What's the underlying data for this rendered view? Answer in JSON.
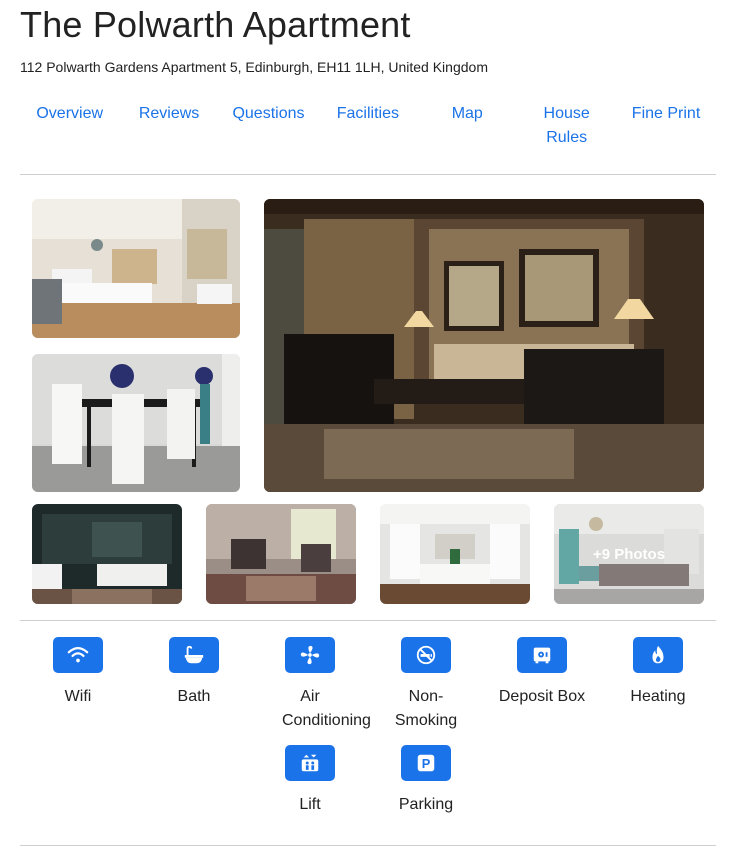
{
  "header": {
    "title": "The Polwarth Apartment",
    "address": "112 Polwarth Gardens Apartment 5, Edinburgh, EH11 1LH, United Kingdom"
  },
  "nav": [
    "Overview",
    "Reviews",
    "Questions",
    "Facilities",
    "Map",
    "House Rules",
    "Fine Print"
  ],
  "gallery": {
    "photos": [
      "bedroom-photo",
      "dining-room-photo",
      "living-room-photo",
      "bathroom-photo",
      "chairs-photo",
      "kitchen-photo",
      "lounge-photo"
    ],
    "more_photos_label": "+9 Photos"
  },
  "facilities": [
    {
      "label": "Wifi",
      "icon": "wifi-icon"
    },
    {
      "label": "Bath",
      "icon": "bath-icon"
    },
    {
      "label": "Air Conditioning",
      "icon": "fan-icon"
    },
    {
      "label": "Non-Smoking",
      "icon": "no-smoking-icon"
    },
    {
      "label": "Deposit Box",
      "icon": "safe-icon"
    },
    {
      "label": "Heating",
      "icon": "flame-icon"
    },
    {
      "label": "Lift",
      "icon": "elevator-icon"
    },
    {
      "label": "Parking",
      "icon": "parking-icon"
    }
  ],
  "colors": {
    "accent": "#1a73e8",
    "text": "#222222",
    "divider": "#cfcfcf"
  }
}
